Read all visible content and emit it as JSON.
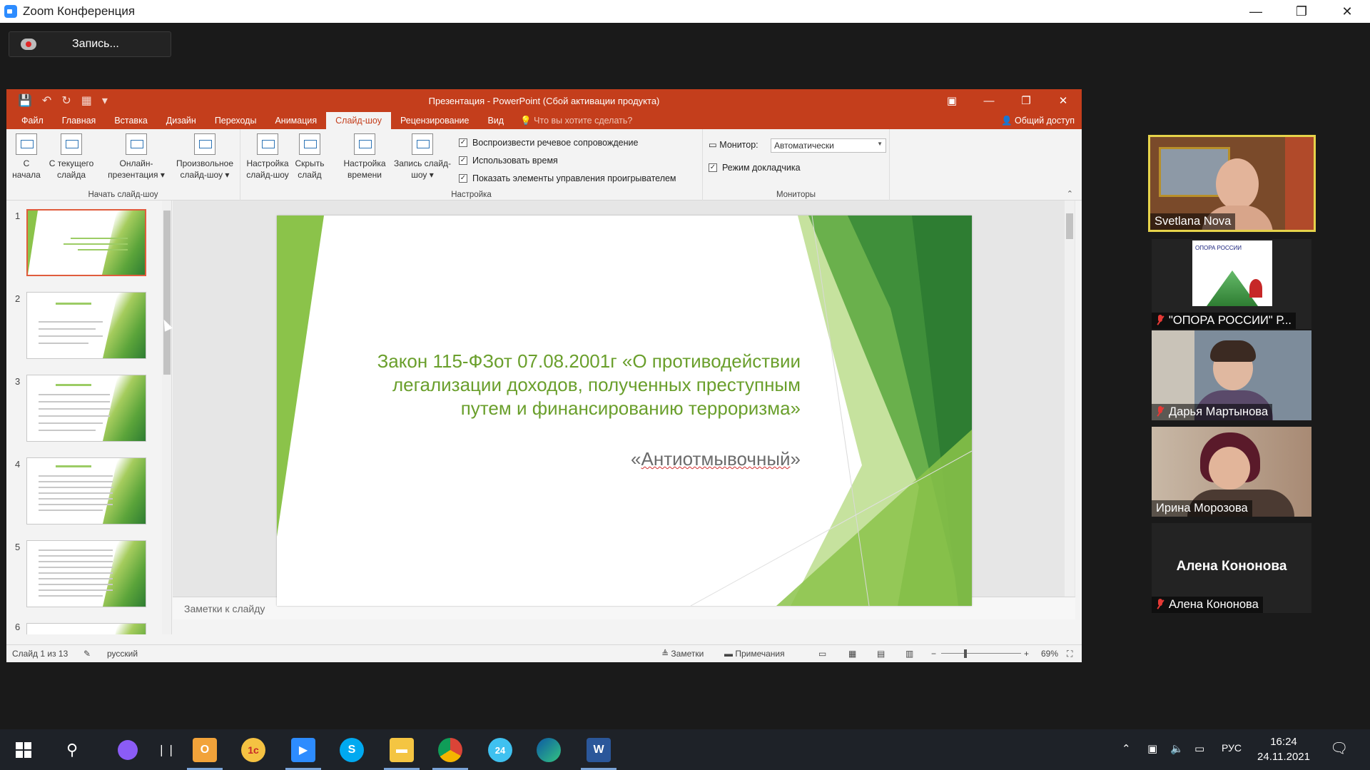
{
  "zoom": {
    "title": "Zoom Конференция",
    "window_controls": {
      "minimize": "—",
      "maximize": "❐",
      "close": "✕"
    },
    "recording_label": "Запись..."
  },
  "powerpoint": {
    "title": "Презентация - PowerPoint (Сбой активации продукта)",
    "title_controls": {
      "ribbon_display": "▣",
      "minimize": "—",
      "maximize": "❐",
      "close": "✕"
    },
    "tabs": [
      "Файл",
      "Главная",
      "Вставка",
      "Дизайн",
      "Переходы",
      "Анимация",
      "Слайд-шоу",
      "Рецензирование",
      "Вид"
    ],
    "active_tab": "Слайд-шоу",
    "tell_me": "Что вы хотите сделать?",
    "share": "Общий доступ",
    "ribbon": {
      "start_group": {
        "label": "Начать слайд-шоу",
        "buttons": [
          {
            "line1": "С",
            "line2": "начала"
          },
          {
            "line1": "С текущего",
            "line2": "слайда"
          },
          {
            "line1": "Онлайн-",
            "line2": "презентация ▾"
          },
          {
            "line1": "Произвольное",
            "line2": "слайд-шоу ▾"
          }
        ]
      },
      "setup_group": {
        "label": "Настройка",
        "buttons": [
          {
            "line1": "Настройка",
            "line2": "слайд-шоу"
          },
          {
            "line1": "Скрыть",
            "line2": "слайд"
          },
          {
            "line1": "Настройка",
            "line2": "времени"
          },
          {
            "line1": "Запись слайд-",
            "line2": "шоу ▾"
          }
        ],
        "checkboxes": [
          {
            "label": "Воспроизвести речевое сопровождение",
            "checked": true
          },
          {
            "label": "Использовать время",
            "checked": true
          },
          {
            "label": "Показать элементы управления проигрывателем",
            "checked": true
          }
        ]
      },
      "monitors_group": {
        "label": "Мониторы",
        "monitor_label": "Монитор:",
        "monitor_value": "Автоматически",
        "presenter_view": {
          "label": "Режим докладчика",
          "checked": true
        }
      }
    },
    "thumbnails": [
      "1",
      "2",
      "3",
      "4",
      "5",
      "6"
    ],
    "slide": {
      "title": "Закон 115-ФЗот 07.08.2001г «О противодействии легализации доходов, полученных преступным путем и финансированию терроризма»",
      "subtitle_open": "«",
      "subtitle_word": "Антиотмывочный",
      "subtitle_close": "»"
    },
    "notes_placeholder": "Заметки к слайду",
    "status": {
      "slide_count": "Слайд 1 из 13",
      "language": "русский",
      "notes": "Заметки",
      "comments": "Примечания",
      "zoom": "69%"
    },
    "accent_color": "#c43e1c",
    "slide_green": "#6a9f2c"
  },
  "participants": [
    {
      "name": "Svetlana Nova",
      "muted": false,
      "active_speaker": true
    },
    {
      "name": "\"ОПОРА РОССИИ\" Р...",
      "muted": true,
      "logo_text": "ОПОРА РОССИИ"
    },
    {
      "name": "Дарья Мартынова",
      "muted": true
    },
    {
      "name": "Ирина Морозова",
      "muted": false
    },
    {
      "name": "Алена Кононова",
      "muted": true,
      "avatar_text": "Алена Кононова"
    }
  ],
  "taskbar": {
    "apps": [
      "windows-start",
      "search",
      "cortana",
      "task-view",
      "outlook",
      "1c",
      "zoom",
      "skype",
      "file-explorer",
      "chrome",
      "bitrix24",
      "edge",
      "word"
    ],
    "icon_labels": {
      "onec": "1c",
      "bitrix": "24",
      "skype": "S",
      "word": "W"
    },
    "language": "РУС",
    "time": "16:24",
    "date": "24.11.2021"
  }
}
